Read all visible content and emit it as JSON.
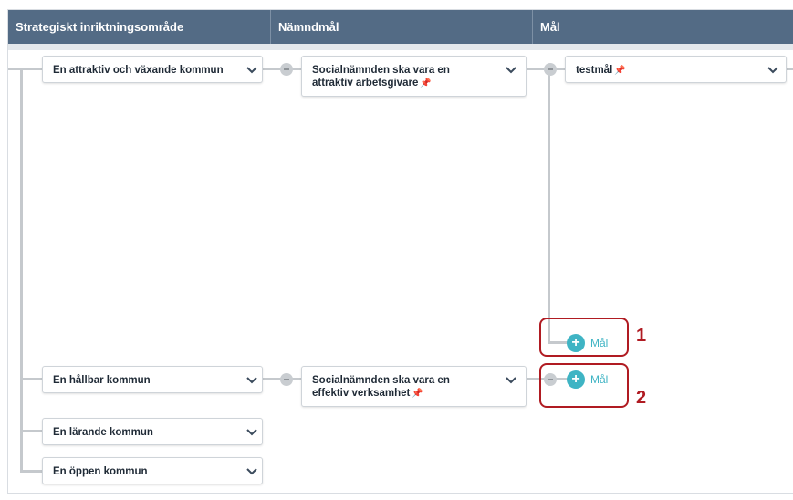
{
  "columns": [
    "Strategiskt inriktningsområde",
    "Nämndmål",
    "Mål"
  ],
  "areas": [
    {
      "label": "En attraktiv och växande kommun"
    },
    {
      "label": "En hållbar kommun"
    },
    {
      "label": "En lärande kommun"
    },
    {
      "label": "En öppen kommun"
    }
  ],
  "board_goals": [
    {
      "line1": "Socialnämnden ska vara en",
      "line2": "attraktiv arbetsgivare"
    },
    {
      "line1": "Socialnämnden ska vara en",
      "line2": "effektiv verksamhet"
    }
  ],
  "goals": [
    {
      "label": "testmål"
    }
  ],
  "add_goal_label": "Mål",
  "callouts": [
    "1",
    "2"
  ],
  "colors": {
    "header": "#536b85",
    "accent": "#3fb4c4",
    "callout": "#b01b22"
  }
}
